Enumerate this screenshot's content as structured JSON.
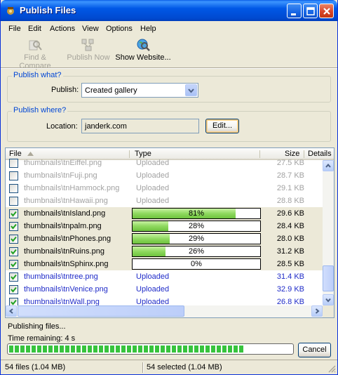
{
  "window": {
    "title": "Publish Files"
  },
  "menu": [
    "File",
    "Edit",
    "Actions",
    "View",
    "Options",
    "Help"
  ],
  "toolbar": {
    "find_compare": "Find & Compare",
    "publish_now": "Publish Now",
    "show_website": "Show Website..."
  },
  "publish_what": {
    "group_title": "Publish what?",
    "label": "Publish:",
    "value": "Created gallery"
  },
  "publish_where": {
    "group_title": "Publish where?",
    "label": "Location:",
    "value": "janderk.com",
    "edit_button": "Edit..."
  },
  "list": {
    "columns": {
      "file": "File",
      "type": "Type",
      "size": "Size",
      "details": "Details"
    },
    "rows": [
      {
        "file": "thumbnails\\tnEiffel.png",
        "type": "Uploaded",
        "size": "27.5 KB",
        "checked": false,
        "state": "grey"
      },
      {
        "file": "thumbnails\\tnFuji.png",
        "type": "Uploaded",
        "size": "28.7 KB",
        "checked": false,
        "state": "grey"
      },
      {
        "file": "thumbnails\\tnHammock.png",
        "type": "Uploaded",
        "size": "29.1 KB",
        "checked": false,
        "state": "grey"
      },
      {
        "file": "thumbnails\\tnHawaii.png",
        "type": "Uploaded",
        "size": "28.8 KB",
        "checked": false,
        "state": "grey"
      },
      {
        "file": "thumbnails\\tnIsland.png",
        "progress": 81,
        "progress_label": "81%",
        "size": "29.6 KB",
        "checked": true,
        "state": "active"
      },
      {
        "file": "thumbnails\\tnpalm.png",
        "progress": 28,
        "progress_label": "28%",
        "size": "28.4 KB",
        "checked": true,
        "state": "active"
      },
      {
        "file": "thumbnails\\tnPhones.png",
        "progress": 29,
        "progress_label": "29%",
        "size": "28.0 KB",
        "checked": true,
        "state": "active"
      },
      {
        "file": "thumbnails\\tnRuins.png",
        "progress": 26,
        "progress_label": "26%",
        "size": "31.2 KB",
        "checked": true,
        "state": "active"
      },
      {
        "file": "thumbnails\\tnSphinx.png",
        "progress": 0,
        "progress_label": "0%",
        "size": "28.5 KB",
        "checked": true,
        "state": "active"
      },
      {
        "file": "thumbnails\\tntree.png",
        "type": "Uploaded",
        "size": "31.4 KB",
        "checked": true,
        "state": "blue"
      },
      {
        "file": "thumbnails\\tnVenice.png",
        "type": "Uploaded",
        "size": "32.9 KB",
        "checked": true,
        "state": "blue"
      },
      {
        "file": "thumbnails\\tnWall.png",
        "type": "Uploaded",
        "size": "26.8 KB",
        "checked": true,
        "state": "blue"
      }
    ]
  },
  "progress": {
    "status": "Publishing files...",
    "time_remaining": "Time remaining: 4 s",
    "fraction": 0.82,
    "cancel_button": "Cancel"
  },
  "statusbar": {
    "files": "54 files (1.04 MB)",
    "selected": "54 selected (1.04 MB)"
  },
  "colors": {
    "title_blue": "#0058e6",
    "link_blue": "#1f2bc8",
    "group_title": "#0046d5",
    "progress_green": "#37c33d"
  },
  "icons": [
    "app-icon",
    "minimize-icon",
    "maximize-icon",
    "close-icon",
    "find-compare-icon",
    "publish-now-icon",
    "show-website-icon",
    "sort-ascending-icon",
    "dropdown-arrow-icon",
    "checkbox-check-icon"
  ]
}
